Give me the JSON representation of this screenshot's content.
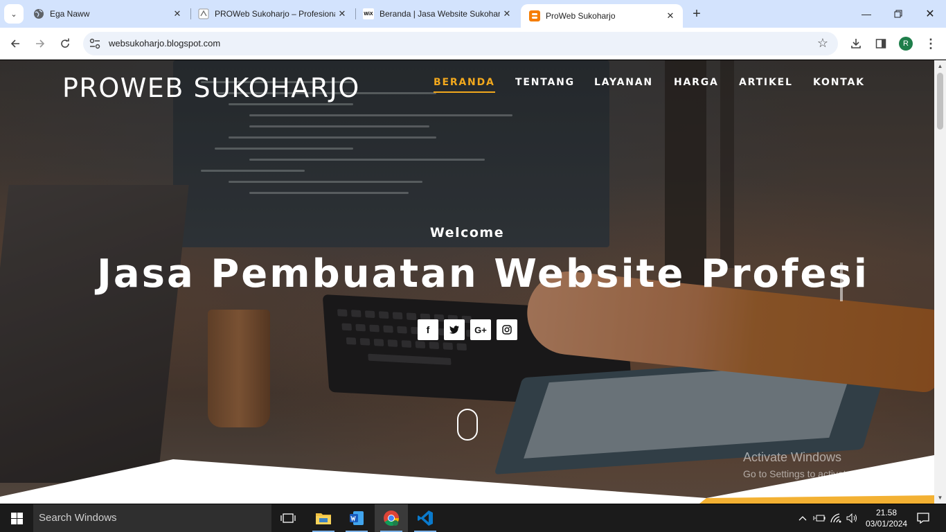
{
  "browser": {
    "tabs": [
      {
        "title": "Ega Naww",
        "icon": "globe-icon",
        "active": false
      },
      {
        "title": "PROWeb Sukoharjo – Profesional",
        "icon": "proweb-favicon",
        "active": false
      },
      {
        "title": "Beranda | Jasa Website Sukohar",
        "icon": "wix-favicon",
        "icon_text": "WiX",
        "active": false
      },
      {
        "title": "ProWeb Sukoharjo",
        "icon": "blogger-icon",
        "active": true
      }
    ],
    "url": "websukoharjo.blogspot.com",
    "profile_initial": "R",
    "accent": "#d3e3fd"
  },
  "site": {
    "brand": "PROWEB SUKOHARJO",
    "nav": [
      {
        "label": "BERANDA",
        "active": true
      },
      {
        "label": "TENTANG",
        "active": false
      },
      {
        "label": "LAYANAN",
        "active": false
      },
      {
        "label": "HARGA",
        "active": false
      },
      {
        "label": "ARTIKEL",
        "active": false
      },
      {
        "label": "KONTAK",
        "active": false
      }
    ],
    "welcome": "Welcome",
    "headline": "Jasa Pembuatan Website Profesi",
    "social": [
      {
        "icon": "facebook-icon",
        "glyph": "f"
      },
      {
        "icon": "twitter-icon",
        "glyph": "t"
      },
      {
        "icon": "google-plus-icon",
        "glyph": "G+"
      },
      {
        "icon": "instagram-icon",
        "glyph": "◎"
      }
    ],
    "nav_active_color": "#f2a81d"
  },
  "watermark": {
    "line1": "Activate Windows",
    "line2": "Go to Settings to activate Windows."
  },
  "taskbar": {
    "search_placeholder": "Search Windows",
    "time": "21.58",
    "date": "03/01/2024"
  }
}
